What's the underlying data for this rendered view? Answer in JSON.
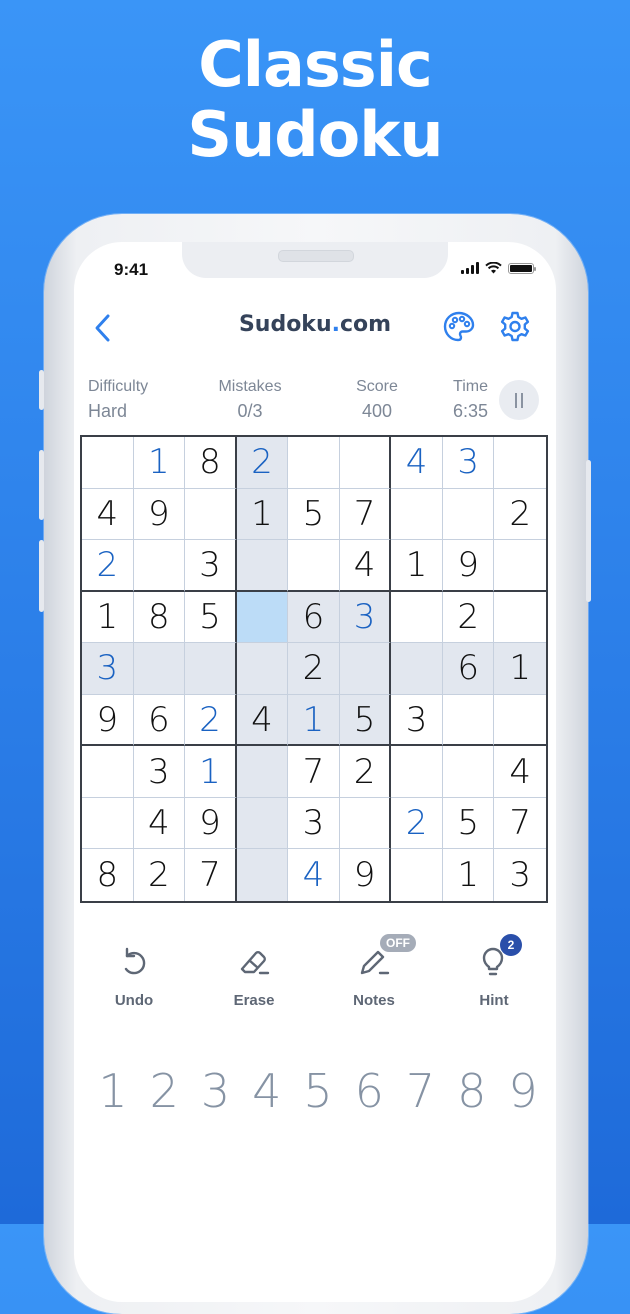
{
  "headline": {
    "line1": "Classic",
    "line2": "Sudoku"
  },
  "status_bar": {
    "time": "9:41"
  },
  "nav": {
    "title_main": "Sudoku",
    "title_dot": ".",
    "title_tld": "com"
  },
  "stats": {
    "difficulty": {
      "label": "Difficulty",
      "value": "Hard"
    },
    "mistakes": {
      "label": "Mistakes",
      "value": "0/3"
    },
    "score": {
      "label": "Score",
      "value": "400"
    },
    "time": {
      "label": "Time",
      "value": "6:35"
    }
  },
  "grid": {
    "values": [
      [
        "",
        "1",
        "8",
        "2",
        "",
        "",
        "4",
        "3",
        ""
      ],
      [
        "4",
        "9",
        "",
        "1",
        "5",
        "7",
        "",
        "",
        "2"
      ],
      [
        "2",
        "",
        "3",
        "",
        "",
        "4",
        "1",
        "9",
        ""
      ],
      [
        "1",
        "8",
        "5",
        "",
        "6",
        "3",
        "",
        "2",
        ""
      ],
      [
        "3",
        "",
        "",
        "",
        "2",
        "",
        "",
        "6",
        "1"
      ],
      [
        "9",
        "6",
        "2",
        "4",
        "1",
        "5",
        "3",
        "",
        ""
      ],
      [
        "",
        "3",
        "1",
        "",
        "7",
        "2",
        "",
        "",
        "4"
      ],
      [
        "",
        "4",
        "9",
        "",
        "3",
        "",
        "2",
        "5",
        "7"
      ],
      [
        "8",
        "2",
        "7",
        "",
        "4",
        "9",
        "",
        "1",
        "3"
      ]
    ],
    "user_entered": [
      [
        0,
        1
      ],
      [
        0,
        3
      ],
      [
        0,
        6
      ],
      [
        0,
        7
      ],
      [
        2,
        0
      ],
      [
        3,
        5
      ],
      [
        4,
        0
      ],
      [
        5,
        2
      ],
      [
        5,
        4
      ],
      [
        6,
        2
      ],
      [
        7,
        6
      ],
      [
        8,
        4
      ]
    ],
    "selected": [
      3,
      3
    ],
    "highlight_row": 4,
    "highlight_col": 3,
    "highlight_box": [
      1,
      1
    ]
  },
  "tools": [
    {
      "label": "Undo",
      "icon": "undo-icon"
    },
    {
      "label": "Erase",
      "icon": "eraser-icon"
    },
    {
      "label": "Notes",
      "icon": "pencil-icon",
      "badge": "OFF"
    },
    {
      "label": "Hint",
      "icon": "lightbulb-icon",
      "badge": "2"
    }
  ],
  "numpad": [
    "1",
    "2",
    "3",
    "4",
    "5",
    "6",
    "7",
    "8",
    "9"
  ],
  "colors": {
    "accent": "#2f80ed",
    "user_digit": "#1a62c2",
    "highlight": "#e2e7ef",
    "selected": "#bcdcf7"
  }
}
